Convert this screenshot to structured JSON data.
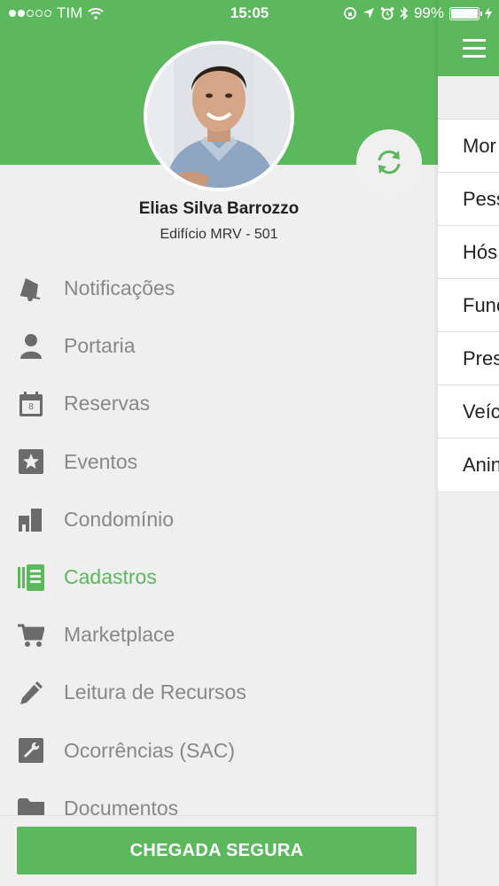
{
  "status_bar": {
    "carrier": "TIM",
    "time": "15:05",
    "battery": "99%",
    "signal_dots_total": 5,
    "signal_dots_filled": 2,
    "battery_level": 0.99
  },
  "user": {
    "name": "Elias Silva Barrozzo",
    "subtitle": "Edifício MRV - 501"
  },
  "menu": {
    "items": [
      {
        "label": "Notificações",
        "icon": "bell-icon",
        "active": false
      },
      {
        "label": "Portaria",
        "icon": "person-icon",
        "active": false
      },
      {
        "label": "Reservas",
        "icon": "calendar-icon",
        "active": false
      },
      {
        "label": "Eventos",
        "icon": "star-icon",
        "active": false
      },
      {
        "label": "Condomínio",
        "icon": "building-icon",
        "active": false
      },
      {
        "label": "Cadastros",
        "icon": "register-icon",
        "active": true
      },
      {
        "label": "Marketplace",
        "icon": "cart-icon",
        "active": false
      },
      {
        "label": "Leitura de Recursos",
        "icon": "pencil-icon",
        "active": false
      },
      {
        "label": "Ocorrências (SAC)",
        "icon": "wrench-icon",
        "active": false
      },
      {
        "label": "Documentos",
        "icon": "folder-icon",
        "active": false
      }
    ],
    "calendar_day": "8"
  },
  "footer": {
    "button_label": "CHEGADA SEGURA"
  },
  "panel": {
    "items": [
      "Mor",
      "Pess",
      "Hós",
      "Func",
      "Pres",
      "Veíc",
      "Anin"
    ]
  },
  "colors": {
    "brand_green": "#5cb85c",
    "menu_text": "#888888",
    "icon_gray": "#6b6b6b"
  }
}
